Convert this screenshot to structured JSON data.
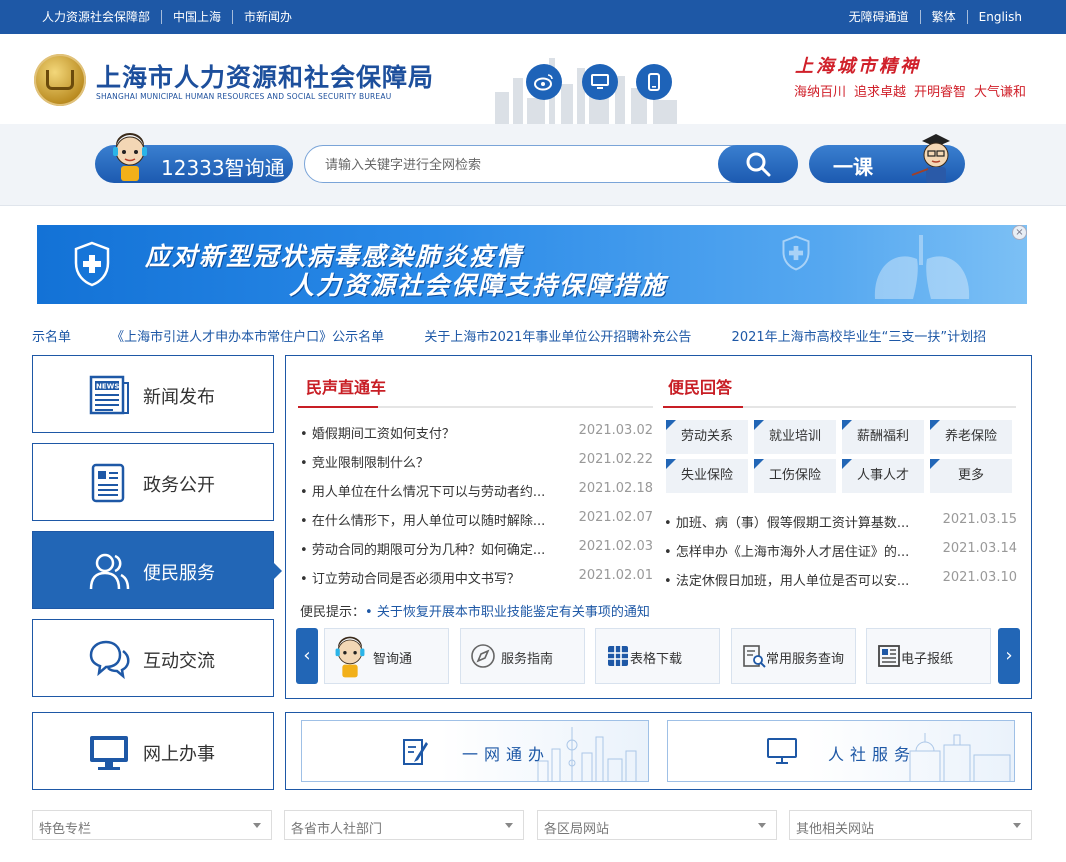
{
  "topbar": {
    "left_links": [
      "人力资源社会保障部",
      "中国上海",
      "市新闻办"
    ],
    "right_links": [
      "无障碍通道",
      "繁体",
      "English"
    ]
  },
  "header": {
    "title": "上海市人力资源和社会保障局",
    "subtitle": "SHANGHAI MUNICIPAL HUMAN RESOURCES AND SOCIAL SECURITY BUREAU",
    "spirit_title": "上海城市精神",
    "spirit_words": [
      "海纳百川",
      "追求卓越",
      "开明睿智",
      "大气谦和"
    ]
  },
  "search": {
    "hotline_label": "12333智询通",
    "placeholder": "请输入关键字进行全网检索",
    "yike_label": "一课"
  },
  "banner": {
    "line1": "应对新型冠状病毒感染肺炎疫情",
    "line2": "人力资源社会保障支持保障措施"
  },
  "ticker": [
    "示名单",
    "《上海市引进人才申办本市常住户口》公示名单",
    "关于上海市2021年事业单位公开招聘补充公告",
    "2021年上海市高校毕业生“三支一扶”计划招"
  ],
  "nav": [
    {
      "label": "新闻发布"
    },
    {
      "label": "政务公开"
    },
    {
      "label": "便民服务"
    },
    {
      "label": "互动交流"
    },
    {
      "label": "网上办事"
    }
  ],
  "minsheng": {
    "title": "民声直通车",
    "items": [
      {
        "text": "婚假期间工资如何支付？",
        "date": "2021.03.02"
      },
      {
        "text": "竞业限制限制什么？",
        "date": "2021.02.22"
      },
      {
        "text": "用人单位在什么情况下可以与劳动者约...",
        "date": "2021.02.18"
      },
      {
        "text": "在什么情形下，用人单位可以随时解除...",
        "date": "2021.02.07"
      },
      {
        "text": "劳动合同的期限可分为几种？如何确定...",
        "date": "2021.02.03"
      },
      {
        "text": "订立劳动合同是否必须用中文书写？",
        "date": "2021.02.01"
      }
    ]
  },
  "bianmin": {
    "title": "便民回答",
    "tags": [
      "劳动关系",
      "就业培训",
      "薪酬福利",
      "养老保险",
      "失业保险",
      "工伤保险",
      "人事人才",
      "更多"
    ],
    "items": [
      {
        "text": "加班、病（事）假等假期工资计算基数...",
        "date": "2021.03.15"
      },
      {
        "text": "怎样申办《上海市海外人才居住证》的...",
        "date": "2021.03.14"
      },
      {
        "text": "法定休假日加班，用人单位是否可以安...",
        "date": "2021.03.10"
      }
    ]
  },
  "tip": {
    "label": "便民提示：",
    "link": "关于恢复开展本市职业技能鉴定有关事项的通知"
  },
  "services": [
    "智询通",
    "服务指南",
    "表格下载",
    "常用服务查询",
    "电子报纸"
  ],
  "service_banners": [
    "一网通办",
    "人社服务"
  ],
  "dropdowns": [
    "特色专栏",
    "各省市人社部门",
    "各区局网站",
    "其他相关网站"
  ]
}
